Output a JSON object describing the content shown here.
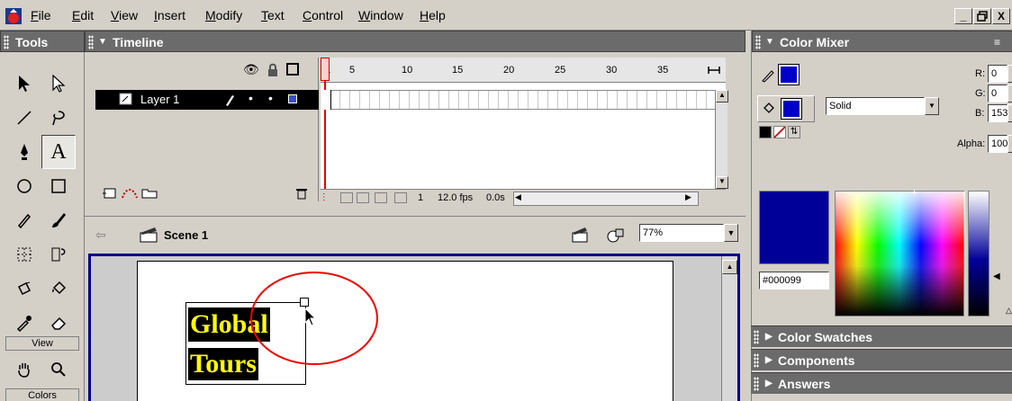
{
  "menu": {
    "items": [
      {
        "pre": "",
        "key": "F",
        "post": "ile"
      },
      {
        "pre": "",
        "key": "E",
        "post": "dit"
      },
      {
        "pre": "",
        "key": "V",
        "post": "iew"
      },
      {
        "pre": "",
        "key": "I",
        "post": "nsert"
      },
      {
        "pre": "",
        "key": "M",
        "post": "odify"
      },
      {
        "pre": "",
        "key": "T",
        "post": "ext"
      },
      {
        "pre": "",
        "key": "C",
        "post": "ontrol"
      },
      {
        "pre": "",
        "key": "W",
        "post": "indow"
      },
      {
        "pre": "",
        "key": "H",
        "post": "elp"
      }
    ],
    "window_buttons": [
      "_",
      "̅□",
      "X"
    ]
  },
  "tools": {
    "title": "Tools",
    "view_label": "View",
    "colors_label": "Colors",
    "text_tool_glyph": "A"
  },
  "timeline": {
    "title": "Timeline",
    "layer_name": "Layer 1",
    "frame_ticks": [
      "1",
      "5",
      "10",
      "15",
      "20",
      "25",
      "30",
      "35"
    ],
    "current_frame": "1",
    "fps": "12.0 fps",
    "elapsed": "0.0s"
  },
  "stage": {
    "scene_name": "Scene 1",
    "zoom": "77%",
    "text_line1": "Global",
    "text_line2": "Tours"
  },
  "color_mixer": {
    "title": "Color Mixer",
    "r_label": "R:",
    "r_value": "0",
    "g_label": "G:",
    "g_value": "0",
    "b_label": "B:",
    "b_value": "153",
    "alpha_label": "Alpha:",
    "alpha_value": "100%",
    "fill_style": "Solid",
    "hex_value": "#000099",
    "swatch_color": "#000099"
  },
  "panels": {
    "color_swatches": "Color Swatches",
    "components": "Components",
    "answers": "Answers"
  }
}
